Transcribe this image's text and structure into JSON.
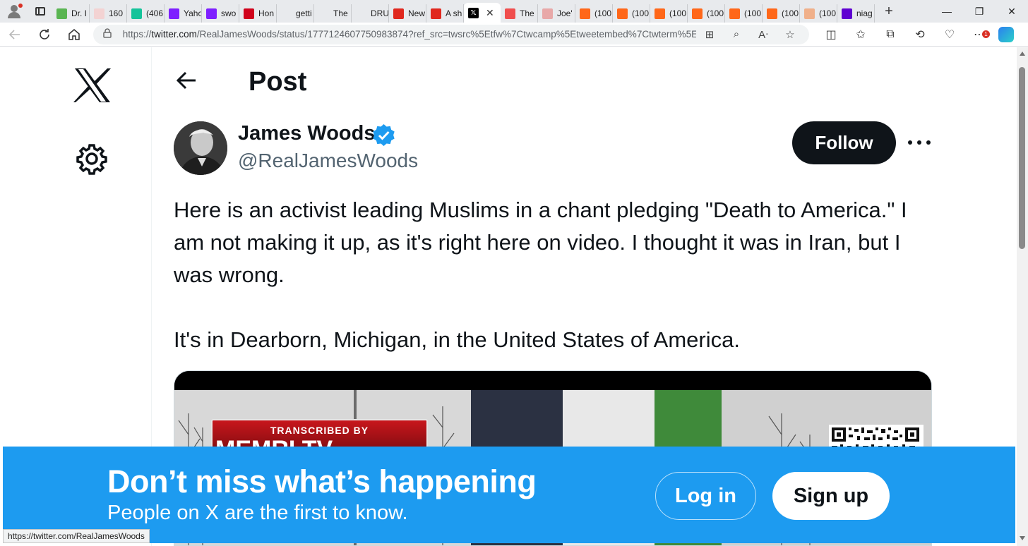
{
  "browser": {
    "tabs": [
      {
        "title": "Dr. I",
        "favicon": "play-icon",
        "color": "#5ab552"
      },
      {
        "title": "160",
        "favicon": "business-insider-icon",
        "color": "#f3d3d3"
      },
      {
        "title": "(406",
        "favicon": "grammarly-icon",
        "color": "#15c39a"
      },
      {
        "title": "Yaho",
        "favicon": "yahoo-icon",
        "color": "#7e1fff"
      },
      {
        "title": "swo",
        "favicon": "yahoo-icon",
        "color": "#7e1fff"
      },
      {
        "title": "Hon",
        "favicon": "news-icon",
        "color": "#d0021b"
      },
      {
        "title": "getti",
        "favicon": "search-icon",
        "color": "#e8eaed"
      },
      {
        "title": "The",
        "favicon": "news-icon",
        "color": "#e8eaed"
      },
      {
        "title": "DRU",
        "favicon": "drudge-icon",
        "color": "#e8eaed"
      },
      {
        "title": "New",
        "favicon": "reddit-icon",
        "color": "#e0281e"
      },
      {
        "title": "A sh",
        "favicon": "reddit-icon",
        "color": "#e0281e"
      },
      {
        "title": "",
        "favicon": "x-icon",
        "color": "#000000"
      },
      {
        "title": "The",
        "favicon": "youtube-icon",
        "color": "#f04e4e"
      },
      {
        "title": "Joe'",
        "favicon": "reddit-icon",
        "color": "#e8a8a8"
      },
      {
        "title": "(100",
        "favicon": "substack-icon",
        "color": "#ff6719"
      },
      {
        "title": "(100",
        "favicon": "substack-icon",
        "color": "#ff6719"
      },
      {
        "title": "(100",
        "favicon": "substack-icon",
        "color": "#ff6719"
      },
      {
        "title": "(100",
        "favicon": "substack-icon",
        "color": "#ff6719"
      },
      {
        "title": "(100",
        "favicon": "substack-icon",
        "color": "#ff6719"
      },
      {
        "title": "(100",
        "favicon": "substack-icon",
        "color": "#ff6719"
      },
      {
        "title": "(100",
        "favicon": "substack-icon",
        "color": "#f0b08a"
      },
      {
        "title": "niag",
        "favicon": "yahoo-icon",
        "color": "#5f01d1"
      }
    ],
    "active_tab_close": "✕",
    "new_tab_label": "+",
    "window": {
      "minimize": "—",
      "restore": "❐",
      "close": "✕"
    },
    "url_prefix": "https://",
    "url_host": "twitter.com",
    "url_rest": "/RealJamesWoods/status/1777124607750983874?ref_src=twsrc%5Etfw%7Ctwcamp%5Etweetembed%7Ctwterm%5E177...",
    "status_url": "https://twitter.com/RealJamesWoods",
    "extension_badge": "1"
  },
  "page": {
    "header_title": "Post",
    "tweet": {
      "display_name": "James Woods",
      "handle": "@RealJamesWoods",
      "follow_label": "Follow",
      "text_para1": "Here is an activist leading Muslims in a chant pledging \"Death to America.\" I am not making it up, as it's right here on video. I thought it was in Iran, but I was wrong.",
      "text_para2": "It's in Dearborn, Michigan, in the United States of America.",
      "media": {
        "banner_small": "TRANSCRIBED BY",
        "banner_big": "MEMRI TV"
      }
    },
    "login_banner": {
      "heading": "Don’t miss what’s happening",
      "subheading": "People on X are the first to know.",
      "login_label": "Log in",
      "signup_label": "Sign up"
    }
  },
  "colors": {
    "accent_blue": "#1d9bf0",
    "text_primary": "#0f1419",
    "text_secondary": "#536471"
  }
}
